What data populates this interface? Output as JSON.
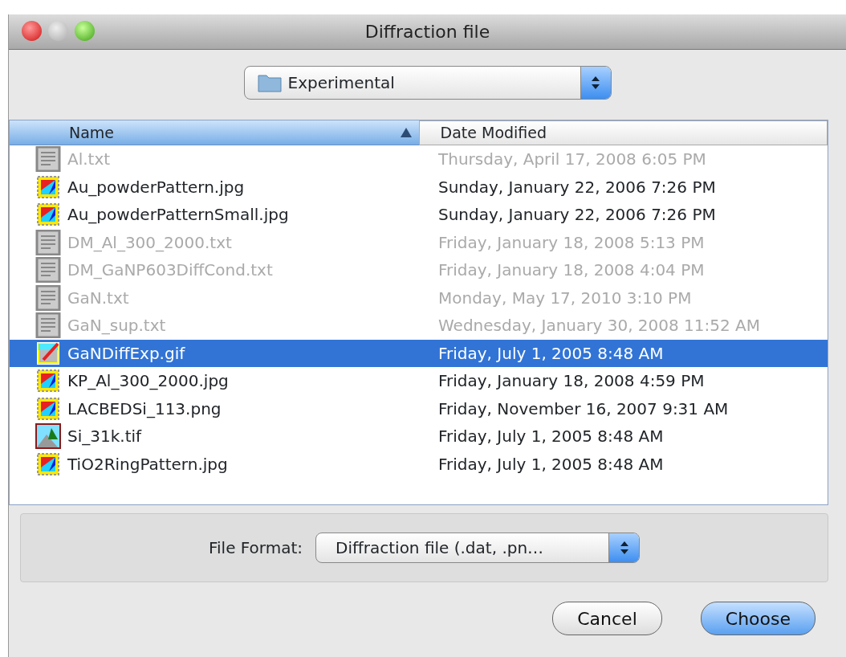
{
  "window": {
    "title": "Diffraction file"
  },
  "folder_popup": {
    "value": "Experimental"
  },
  "table": {
    "columns": [
      {
        "label": "Name",
        "sorted": true
      },
      {
        "label": "Date Modified",
        "sorted": false
      }
    ],
    "rows": [
      {
        "name": "Al.txt",
        "date": "Thursday, April 17, 2008 6:05 PM",
        "kind": "text",
        "disabled": true,
        "selected": false
      },
      {
        "name": "Au_powderPattern.jpg",
        "date": "Sunday, January 22, 2006 7:26 PM",
        "kind": "image",
        "disabled": false,
        "selected": false
      },
      {
        "name": "Au_powderPatternSmall.jpg",
        "date": "Sunday, January 22, 2006 7:26 PM",
        "kind": "image",
        "disabled": false,
        "selected": false
      },
      {
        "name": "DM_Al_300_2000.txt",
        "date": "Friday, January 18, 2008 5:13 PM",
        "kind": "text",
        "disabled": true,
        "selected": false
      },
      {
        "name": "DM_GaNP603DiffCond.txt",
        "date": "Friday, January 18, 2008 4:04 PM",
        "kind": "text",
        "disabled": true,
        "selected": false
      },
      {
        "name": "GaN.txt",
        "date": "Monday, May 17, 2010 3:10 PM",
        "kind": "text",
        "disabled": true,
        "selected": false
      },
      {
        "name": "GaN_sup.txt",
        "date": "Wednesday, January 30, 2008 11:52 AM",
        "kind": "text",
        "disabled": true,
        "selected": false
      },
      {
        "name": "GaNDiffExp.gif",
        "date": "Friday, July 1, 2005 8:48 AM",
        "kind": "drawing",
        "disabled": false,
        "selected": true
      },
      {
        "name": "KP_Al_300_2000.jpg",
        "date": "Friday, January 18, 2008 4:59 PM",
        "kind": "image",
        "disabled": false,
        "selected": false
      },
      {
        "name": "LACBEDSi_113.png",
        "date": "Friday, November 16, 2007 9:31 AM",
        "kind": "image",
        "disabled": false,
        "selected": false
      },
      {
        "name": "Si_31k.tif",
        "date": "Friday, July 1, 2005 8:48 AM",
        "kind": "photo",
        "disabled": false,
        "selected": false
      },
      {
        "name": "TiO2RingPattern.jpg",
        "date": "Friday, July 1, 2005 8:48 AM",
        "kind": "image",
        "disabled": false,
        "selected": false
      }
    ]
  },
  "file_format": {
    "label": "File Format:",
    "value": "Diffraction file (.dat, .pn…"
  },
  "buttons": [
    {
      "label": "Cancel",
      "default": false
    },
    {
      "label": "Choose",
      "default": true
    }
  ]
}
